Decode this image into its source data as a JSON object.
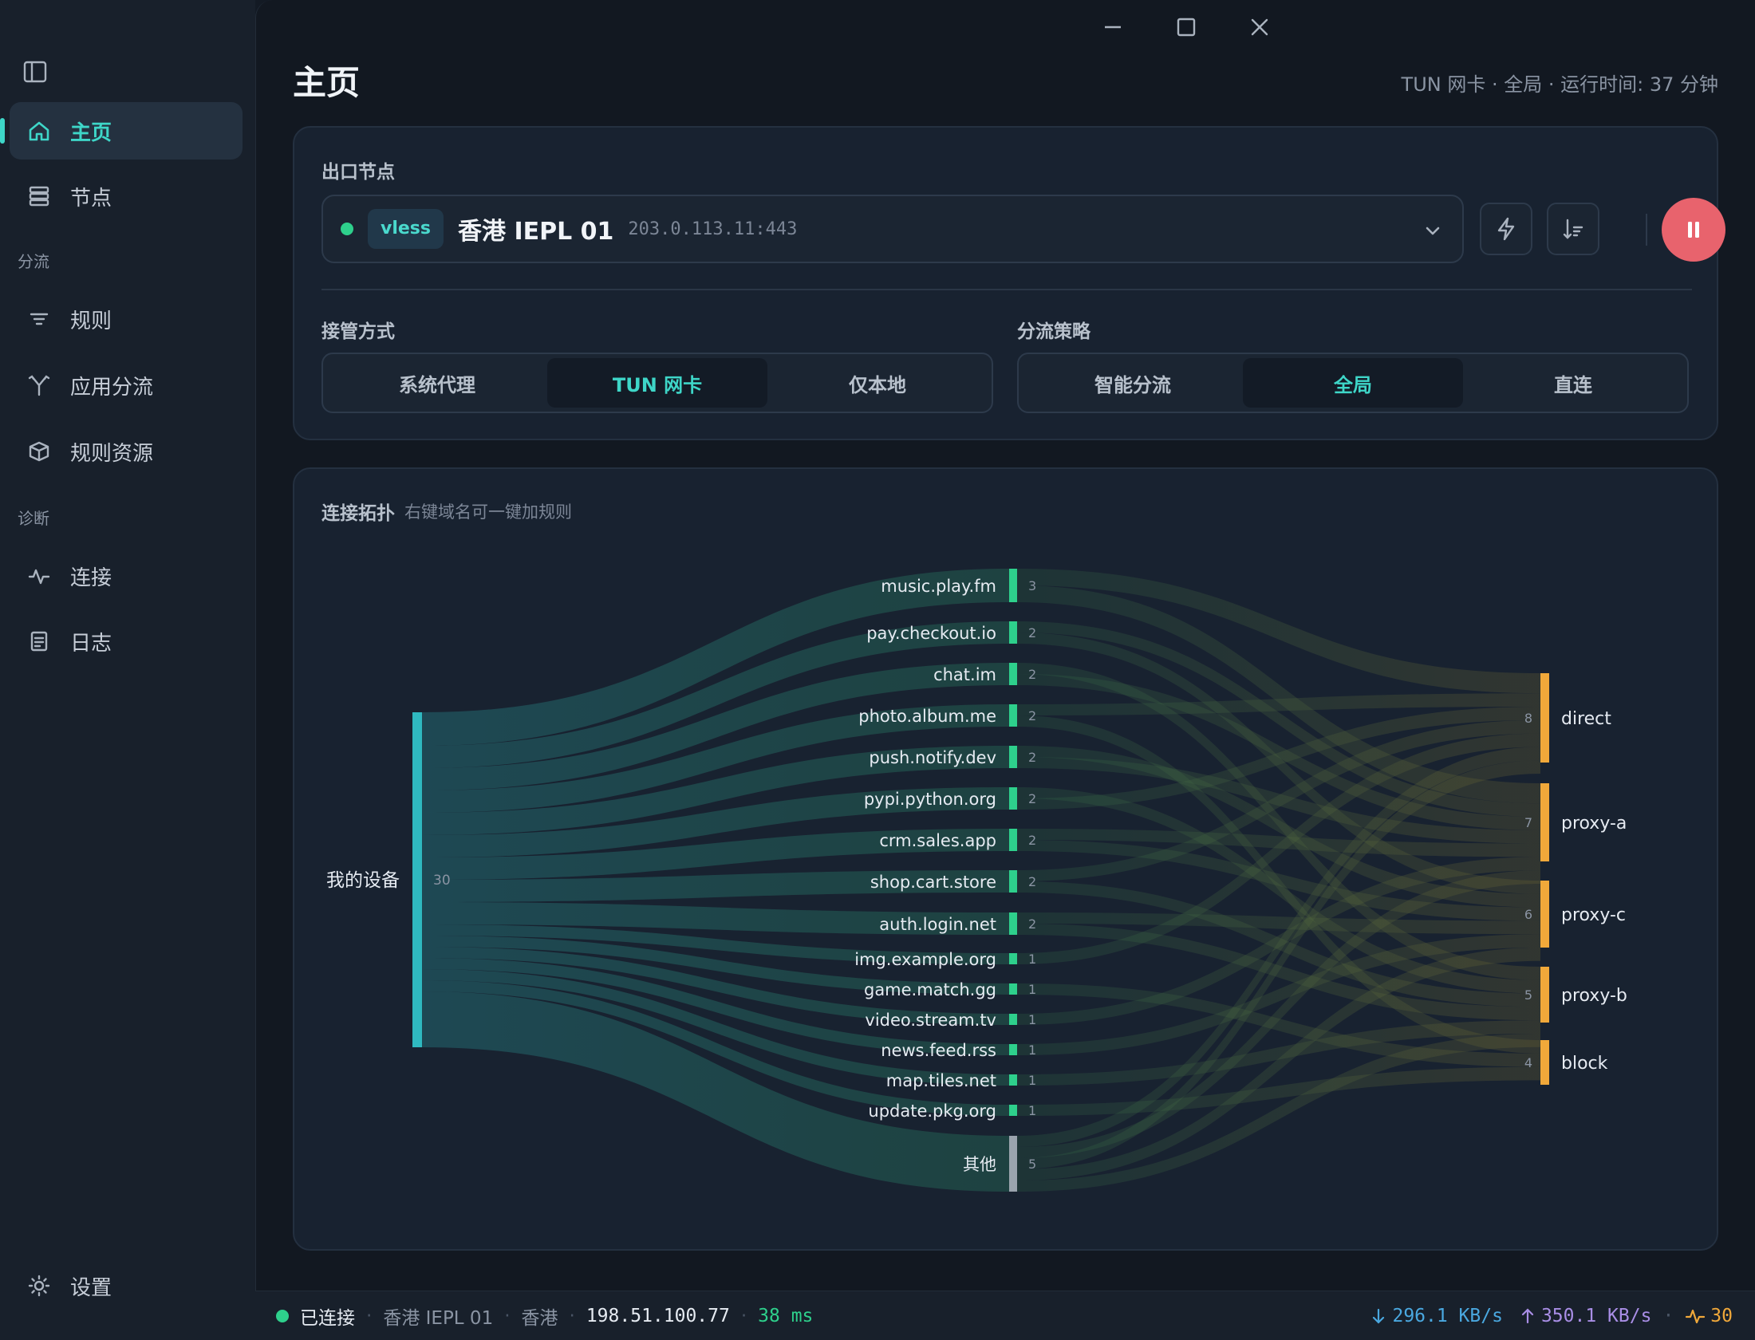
{
  "sidebar": {
    "items": [
      {
        "id": "home",
        "label": "主页"
      },
      {
        "id": "nodes",
        "label": "节点"
      },
      {
        "id": "rules",
        "label": "规则"
      },
      {
        "id": "app_split",
        "label": "应用分流"
      },
      {
        "id": "rule_resources",
        "label": "规则资源"
      },
      {
        "id": "connections",
        "label": "连接"
      },
      {
        "id": "logs",
        "label": "日志"
      }
    ],
    "sections": {
      "split": "分流",
      "diagnose": "诊断"
    },
    "settings_label": "设置",
    "active": "home"
  },
  "header": {
    "title": "主页",
    "status": "TUN 网卡 · 全局 · 运行时间: 37 分钟"
  },
  "exit_node": {
    "label": "出口节点",
    "protocol": "vless",
    "name": "香港 IEPL 01",
    "address": "203.0.113.11:443",
    "status_color": "#2ed08c"
  },
  "takeover": {
    "label": "接管方式",
    "options": [
      "系统代理",
      "TUN 网卡",
      "仅本地"
    ],
    "selected": "TUN 网卡"
  },
  "strategy": {
    "label": "分流策略",
    "options": [
      "智能分流",
      "全局",
      "直连"
    ],
    "selected": "全局"
  },
  "topology": {
    "title": "连接拓扑",
    "hint": "右键域名可一键加规则",
    "source": {
      "name": "我的设备",
      "count": 30
    },
    "domains": [
      {
        "name": "music.play.fm",
        "count": 3
      },
      {
        "name": "pay.checkout.io",
        "count": 2
      },
      {
        "name": "chat.im",
        "count": 2
      },
      {
        "name": "photo.album.me",
        "count": 2
      },
      {
        "name": "push.notify.dev",
        "count": 2
      },
      {
        "name": "pypi.python.org",
        "count": 2
      },
      {
        "name": "crm.sales.app",
        "count": 2
      },
      {
        "name": "shop.cart.store",
        "count": 2
      },
      {
        "name": "auth.login.net",
        "count": 2
      },
      {
        "name": "img.example.org",
        "count": 1
      },
      {
        "name": "game.match.gg",
        "count": 1
      },
      {
        "name": "video.stream.tv",
        "count": 1
      },
      {
        "name": "news.feed.rss",
        "count": 1
      },
      {
        "name": "map.tiles.net",
        "count": 1
      },
      {
        "name": "update.pkg.org",
        "count": 1
      },
      {
        "name": "其他",
        "count": 5
      }
    ],
    "targets": [
      {
        "name": "direct",
        "count": 8
      },
      {
        "name": "proxy-a",
        "count": 7
      },
      {
        "name": "proxy-c",
        "count": 6
      },
      {
        "name": "proxy-b",
        "count": 5
      },
      {
        "name": "block",
        "count": 4
      }
    ],
    "colors": {
      "source": "#2fb9c0",
      "domain": "#2ed08c",
      "other": "#9aa3ad",
      "target": "#f0a83a"
    }
  },
  "footer": {
    "status": "已连接",
    "node": "香港 IEPL 01",
    "region": "香港",
    "ip": "198.51.100.77",
    "latency": "38 ms",
    "down": "296.1 KB/s",
    "up": "350.1 KB/s",
    "connections": "30"
  }
}
